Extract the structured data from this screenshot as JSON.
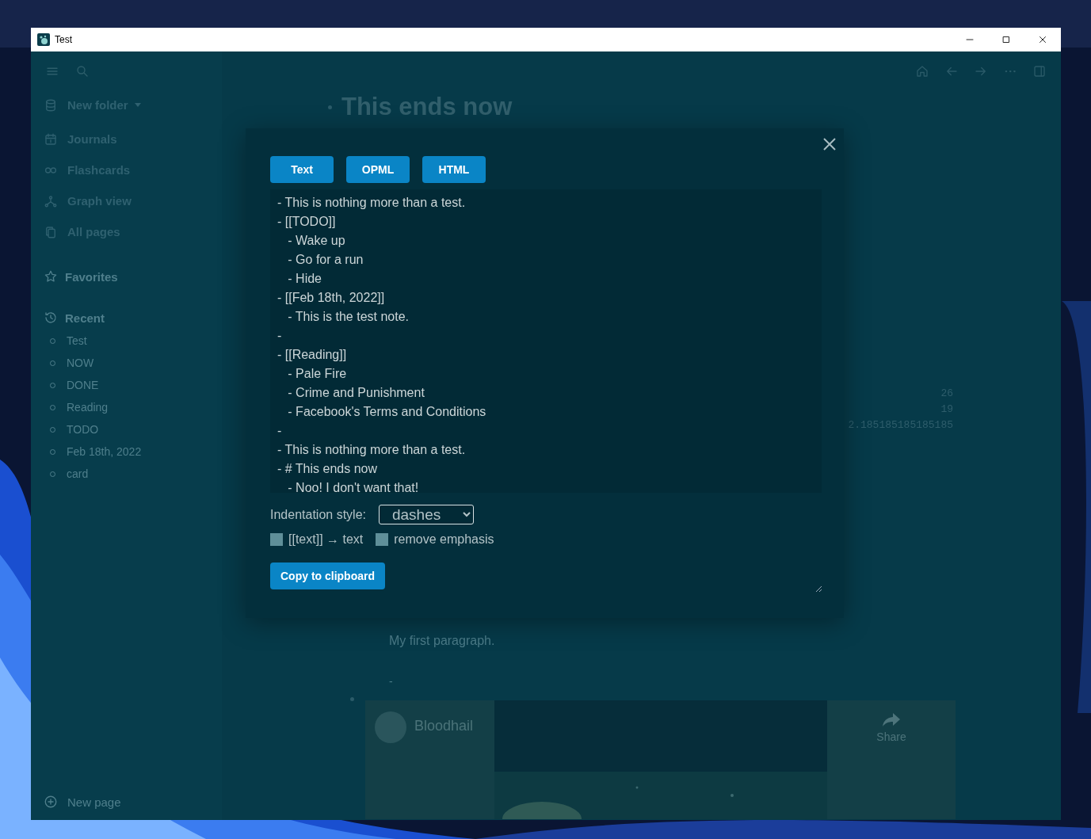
{
  "window": {
    "title": "Test"
  },
  "sidebar": {
    "folder": "New folder",
    "nav": [
      "Journals",
      "Flashcards",
      "Graph view",
      "All pages"
    ],
    "favorites": "Favorites",
    "recent": {
      "label": "Recent",
      "items": [
        "Test",
        "NOW",
        "DONE",
        "Reading",
        "TODO",
        "Feb 18th, 2022",
        "card"
      ]
    },
    "new_page": "New page"
  },
  "page": {
    "title": "This ends now",
    "stats": [
      "26",
      "19",
      "2.185185185185185"
    ],
    "paragraph": "My first paragraph.",
    "empty_block": "-",
    "embed": {
      "channel": "Bloodhail",
      "share": "Share"
    }
  },
  "export_dialog": {
    "formats": [
      "Text",
      "OPML",
      "HTML"
    ],
    "content": "- This is nothing more than a test.\n- [[TODO]]\n   - Wake up\n   - Go for a run\n   - Hide\n- [[Feb 18th, 2022]]\n   - This is the test note.\n- \n- [[Reading]]\n   - Pale Fire\n   - Crime and Punishment\n   - Facebook's Terms and Conditions\n- \n- This is nothing more than a test.\n- # This ends now\n   - Noo! I don't want that!",
    "indentation": {
      "label": "Indentation style:",
      "value": "dashes"
    },
    "options": [
      {
        "label": "[[text]] → text",
        "checked": false
      },
      {
        "label": "remove emphasis",
        "checked": false
      }
    ],
    "copy_button": "Copy to clipboard"
  }
}
